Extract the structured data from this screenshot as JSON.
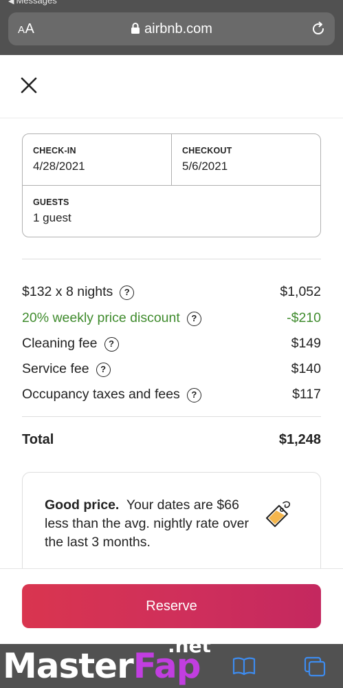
{
  "browser": {
    "back_app": "Messages",
    "text_size_small": "A",
    "text_size_large": "A",
    "url": "airbnb.com"
  },
  "booking": {
    "checkin_label": "CHECK-IN",
    "checkin_value": "4/28/2021",
    "checkout_label": "CHECKOUT",
    "checkout_value": "5/6/2021",
    "guests_label": "GUESTS",
    "guests_value": "1 guest"
  },
  "prices": [
    {
      "label": "$132 x 8 nights",
      "amount": "$1,052"
    },
    {
      "label": "20% weekly price discount",
      "amount": "-$210"
    },
    {
      "label": "Cleaning fee",
      "amount": "$149"
    },
    {
      "label": "Service fee",
      "amount": "$140"
    },
    {
      "label": "Occupancy taxes and fees",
      "amount": "$117"
    }
  ],
  "total": {
    "label": "Total",
    "amount": "$1,248"
  },
  "good_price": {
    "title": "Good price.",
    "text": "Your dates are $66 less than the avg. nightly rate over the last 3 months."
  },
  "reserve_label": "Reserve",
  "watermark": {
    "part1": "Master",
    "part2": "Fap",
    "suffix": ".net"
  },
  "colors": {
    "discount_green": "#3f8b2d",
    "reserve_start": "#d9354f",
    "reserve_end": "#c4285f",
    "safari_chrome": "#515151"
  },
  "icons": {
    "close": "close-icon",
    "help": "question-circle-icon",
    "price_tag": "price-tag-icon",
    "lock": "lock-icon",
    "reload": "reload-icon",
    "bookmarks": "book-icon",
    "tabs": "tabs-icon"
  }
}
